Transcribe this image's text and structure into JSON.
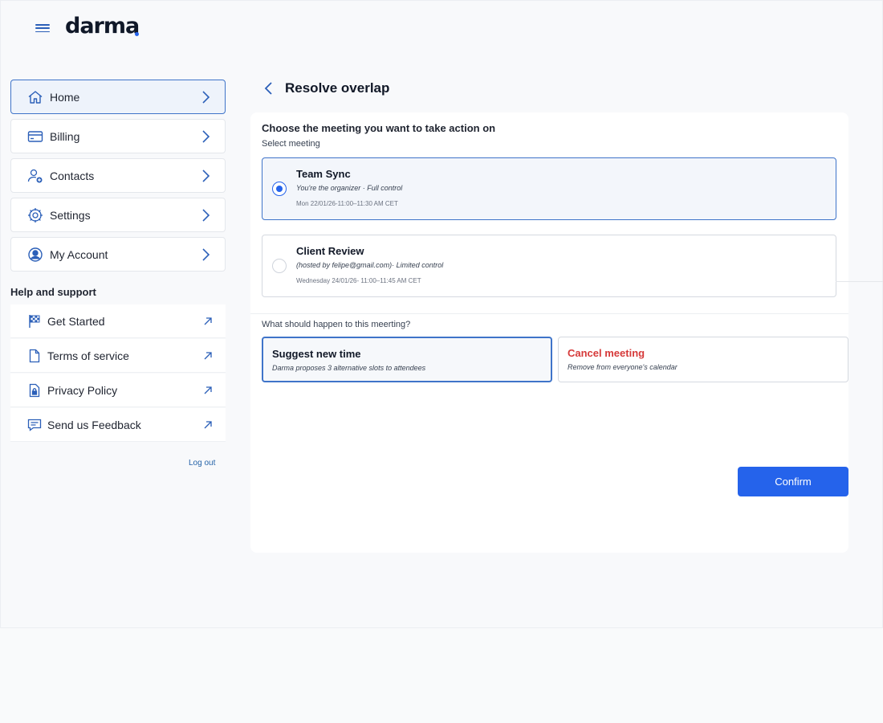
{
  "brand": {
    "name": "darma",
    "accent": "#2563eb"
  },
  "header": {
    "menu_icon": "hamburger-icon"
  },
  "sidebar": {
    "nav": [
      {
        "label": "Home",
        "icon": "home-icon",
        "active": true
      },
      {
        "label": "Billing",
        "icon": "credit-card-icon",
        "active": false
      },
      {
        "label": "Contacts",
        "icon": "add-user-icon",
        "active": false
      },
      {
        "label": "Settings",
        "icon": "gear-icon",
        "active": false
      },
      {
        "label": "My Account",
        "icon": "user-circle-icon",
        "active": false
      }
    ],
    "help_title": "Help and support",
    "help": [
      {
        "label": "Get Started",
        "icon": "flag-icon"
      },
      {
        "label": "Terms of service",
        "icon": "document-icon"
      },
      {
        "label": "Privacy Policy",
        "icon": "lock-document-icon"
      },
      {
        "label": "Send us Feedback",
        "icon": "chat-icon"
      }
    ],
    "logout_label": "Log out"
  },
  "main": {
    "title": "Resolve overlap",
    "heading": "Choose the meeting you want to take action on",
    "select_label": "Select meeting",
    "meetings": [
      {
        "title": "Team Sync",
        "role": "You're the organizer · Full control",
        "time": "Mon 22/01/26-11:00–11:30 AM CET",
        "selected": true
      },
      {
        "title": "Client Review",
        "role": "(hosted by felipe@gmail.com)· Limited control",
        "time": "Wednesday 24/01/26- 11:00–11:45 AM CET",
        "selected": false
      }
    ],
    "question": "What should happen to this meerting?",
    "actions": [
      {
        "title": "Suggest new time",
        "desc": "Darma proposes 3 alternative slots to attendees",
        "selected": true,
        "danger": false
      },
      {
        "title": "Cancel meeting",
        "desc": "Remove from everyone's calendar",
        "selected": false,
        "danger": true
      }
    ],
    "confirm_label": "Confirm"
  }
}
